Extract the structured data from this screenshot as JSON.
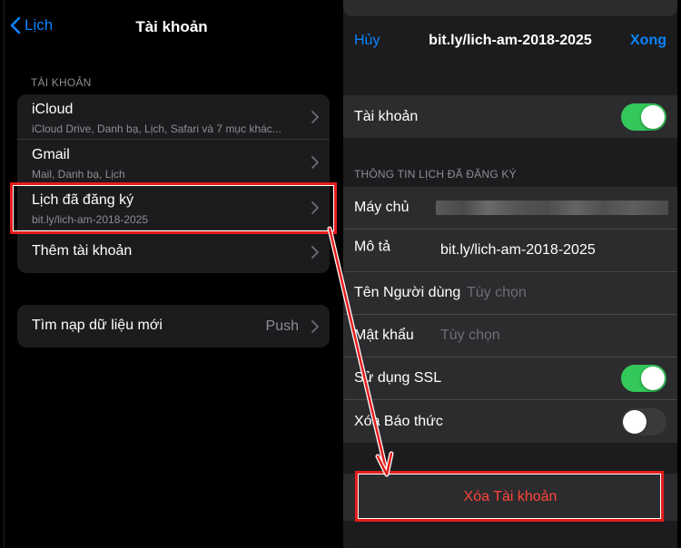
{
  "left": {
    "nav": {
      "back_label": "Lịch",
      "title": "Tài khoản"
    },
    "accounts_header": "TÀI KHOẢN",
    "accounts": [
      {
        "title": "iCloud",
        "subtitle": "iCloud Drive, Danh bạ, Lịch, Safari và 7 mục khác..."
      },
      {
        "title": "Gmail",
        "subtitle": "Mail, Danh bạ, Lịch"
      },
      {
        "title": "Lịch đã đăng ký",
        "subtitle": "bit.ly/lich-am-2018-2025"
      },
      {
        "title": "Thêm tài khoản"
      }
    ],
    "fetch": {
      "title": "Tìm nạp dữ liệu mới",
      "value": "Push"
    }
  },
  "right": {
    "nav": {
      "cancel_label": "Hủy",
      "title": "bit.ly/lich-am-2018-2025",
      "done_label": "Xong"
    },
    "account_toggle": {
      "label": "Tài khoản",
      "on": true
    },
    "section_header": "THÔNG TIN LỊCH ĐÃ ĐĂNG KÝ",
    "fields": {
      "server_label": "Máy chủ",
      "description_label": "Mô tả",
      "description_value": "bit.ly/lich-am-2018-2025",
      "username_label": "Tên Người dùng",
      "username_placeholder": "Tùy chọn",
      "password_label": "Mật khẩu",
      "password_placeholder": "Tùy chọn",
      "ssl_label": "Sử dụng SSL",
      "ssl_on": true,
      "remove_alarms_label": "Xóa Báo thức",
      "remove_alarms_on": false
    },
    "delete_label": "Xóa Tài khoản"
  },
  "colors": {
    "accent_blue": "#0a84ff",
    "toggle_on": "#34c759",
    "destructive": "#ff453a",
    "highlight_red": "#e51d1d"
  }
}
